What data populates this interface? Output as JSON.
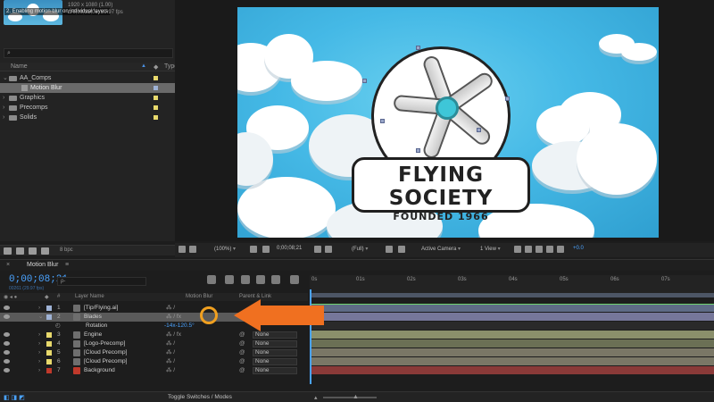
{
  "project": {
    "tip_text": "2. Enabling motion blur on individual layers",
    "comp_info": "1920 x 1080 (1.00)\nΔ 0;00;31;09, 29.97 fps",
    "search_icon": "search-icon",
    "header_name": "Name",
    "header_type": "Type",
    "items": [
      {
        "label": "AA_Comps",
        "arrow": "v"
      },
      {
        "label": "Motion Blur",
        "selected": true
      },
      {
        "label": "Graphics",
        "arrow": ">"
      },
      {
        "label": "Precomps",
        "arrow": ">"
      },
      {
        "label": "Solids",
        "arrow": ">"
      }
    ],
    "bpc": "8 bpc",
    "label_color": "#e8d96c"
  },
  "viewer": {
    "banner_title": "FLYING SOCIETY",
    "banner_sub": "FOUNDED 1966",
    "sky_color": "#45b9e6",
    "toolbar": {
      "zoom": "(100%)",
      "timecode": "0;00;08;21",
      "resolution": "(Full)",
      "camera": "Active Camera",
      "views": "1 View",
      "exposure": "+0.0"
    }
  },
  "timeline": {
    "tab_label": "Motion Blur",
    "close": "×",
    "menu": "≡",
    "timecode": "0;00;08;21",
    "fps": "00261 (29.97 fps)",
    "search_placeholder": "ρ-",
    "columns": {
      "layer_name": "Layer Name",
      "motion_blur": "Motion Blur",
      "parent": "Parent & Link"
    },
    "rotation": {
      "label": "Rotation",
      "value": "-14x-120.5°"
    },
    "ruler": [
      "0s",
      "01s",
      "02s",
      "03s",
      "04s",
      "05s",
      "06s",
      "07s"
    ],
    "layers": [
      {
        "num": "1",
        "name": "[Tip/Flying.ai]",
        "label": "#9fb3d6",
        "bar": "#5e6b86",
        "sw": "⁂ /"
      },
      {
        "num": "2",
        "name": "Blades",
        "label": "#9fb3d6",
        "bar": "#6e6f86",
        "sw": "⁂ / fx",
        "selected": true
      },
      {
        "num": "3",
        "name": "Engine",
        "label": "#e8d96c",
        "bar": "#8a8f6b",
        "sw": "⁂ / fx",
        "parent": "None"
      },
      {
        "num": "4",
        "name": "[Logo-Precomp]",
        "label": "#e8d96c",
        "bar": "#6b7055",
        "sw": "⁂ /",
        "parent": "None"
      },
      {
        "num": "5",
        "name": "[Cloud Precomp]",
        "label": "#e8d96c",
        "bar": "#7a7766",
        "sw": "⁂ /",
        "parent": "None"
      },
      {
        "num": "6",
        "name": "[Cloud Precomp]",
        "label": "#e8d96c",
        "bar": "#7a7766",
        "sw": "⁂ /",
        "parent": "None"
      },
      {
        "num": "7",
        "name": "Background",
        "label": "#c0392b",
        "bar": "#8a3a38",
        "sw": "⁂ /",
        "parent": "None"
      }
    ],
    "toggle_label": "Toggle Switches / Modes",
    "accent": "#4aa3ff",
    "annotation_color": "#f07020"
  }
}
